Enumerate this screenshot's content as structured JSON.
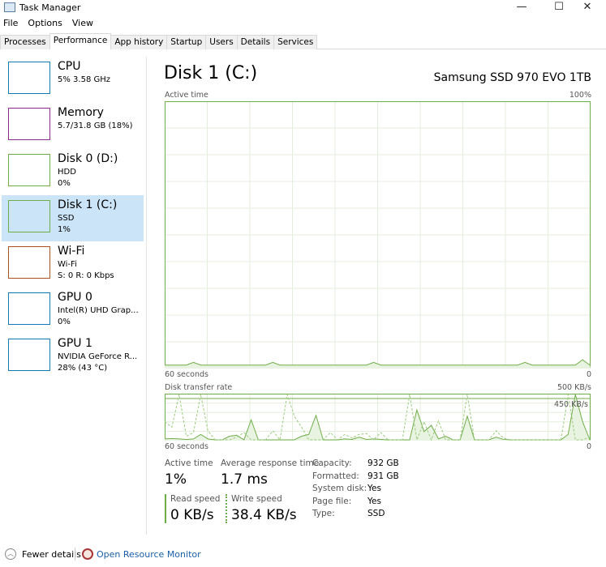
{
  "window": {
    "title": "Task Manager",
    "minimize": "—",
    "maximize": "☐",
    "close": "✕"
  },
  "menu": [
    "File",
    "Options",
    "View"
  ],
  "tabs": [
    "Processes",
    "Performance",
    "App history",
    "Startup",
    "Users",
    "Details",
    "Services"
  ],
  "active_tab": "Performance",
  "sidebar": [
    {
      "name": "CPU",
      "line1": "5% 3.58 GHz",
      "line2": "",
      "color": "#1479b8"
    },
    {
      "name": "Memory",
      "line1": "5.7/31.8 GB (18%)",
      "line2": "",
      "color": "#8b2a8b"
    },
    {
      "name": "Disk 0 (D:)",
      "line1": "HDD",
      "line2": "0%",
      "color": "#6fad48"
    },
    {
      "name": "Disk 1 (C:)",
      "line1": "SSD",
      "line2": "1%",
      "color": "#6fad48"
    },
    {
      "name": "Wi-Fi",
      "line1": "Wi-Fi",
      "line2": "S: 0 R: 0 Kbps",
      "color": "#a7501c"
    },
    {
      "name": "GPU 0",
      "line1": "Intel(R) UHD Grap...",
      "line2": "0%",
      "color": "#1479b8"
    },
    {
      "name": "GPU 1",
      "line1": "NVIDIA GeForce R...",
      "line2": "28% (43 °C)",
      "color": "#1479b8"
    }
  ],
  "main": {
    "title": "Disk 1 (C:)",
    "model": "Samsung SSD 970 EVO 1TB",
    "active_chart": {
      "label": "Active time",
      "max": "100%",
      "xleft": "60 seconds",
      "xright": "0",
      "values": [
        1,
        1,
        1,
        1,
        2,
        1,
        1,
        1,
        1,
        1,
        1,
        1,
        1,
        1,
        1,
        2,
        1,
        1,
        1,
        1,
        1,
        1,
        1,
        1,
        1,
        1,
        1,
        1,
        1,
        2,
        1,
        1,
        1,
        1,
        1,
        1,
        1,
        1,
        1,
        1,
        1,
        1,
        1,
        1,
        1,
        1,
        1,
        1,
        1,
        1,
        2,
        1,
        1,
        1,
        1,
        1,
        1,
        1,
        3,
        1
      ]
    },
    "transfer_chart": {
      "label": "Disk transfer rate",
      "max": "500 KB/s",
      "line": "450 KB/s",
      "xleft": "60 seconds",
      "xright": "0",
      "read": [
        10,
        15,
        10,
        5,
        10,
        60,
        10,
        0,
        0,
        40,
        50,
        0,
        220,
        0,
        0,
        0,
        0,
        0,
        0,
        40,
        60,
        270,
        0,
        0,
        0,
        10,
        5,
        30,
        5,
        10,
        5,
        0,
        0,
        0,
        0,
        330,
        90,
        160,
        10,
        40,
        0,
        0,
        260,
        0,
        0,
        0,
        30,
        5,
        0,
        0,
        0,
        0,
        0,
        0,
        0,
        0,
        60,
        500,
        200,
        0
      ],
      "write": [
        200,
        140,
        500,
        40,
        80,
        500,
        100,
        0,
        0,
        0,
        30,
        80,
        0,
        0,
        0,
        100,
        0,
        500,
        260,
        140,
        0,
        0,
        0,
        80,
        0,
        60,
        20,
        60,
        70,
        0,
        80,
        0,
        0,
        0,
        500,
        0,
        200,
        0,
        210,
        0,
        0,
        0,
        500,
        0,
        0,
        0,
        100,
        20,
        0,
        0,
        0,
        0,
        0,
        0,
        0,
        0,
        500,
        0,
        0,
        30
      ]
    },
    "stats": {
      "active_time_label": "Active time",
      "active_time": "1%",
      "response_label": "Average response time",
      "response": "1.7 ms",
      "read_label": "Read speed",
      "read": "0 KB/s",
      "write_label": "Write speed",
      "write": "38.4 KB/s"
    },
    "props": [
      {
        "k": "Capacity:",
        "v": "932 GB"
      },
      {
        "k": "Formatted:",
        "v": "931 GB"
      },
      {
        "k": "System disk:",
        "v": "Yes"
      },
      {
        "k": "Page file:",
        "v": "Yes"
      },
      {
        "k": "Type:",
        "v": "SSD"
      }
    ]
  },
  "footer": {
    "fewer": "Fewer details",
    "monitor": "Open Resource Monitor"
  }
}
